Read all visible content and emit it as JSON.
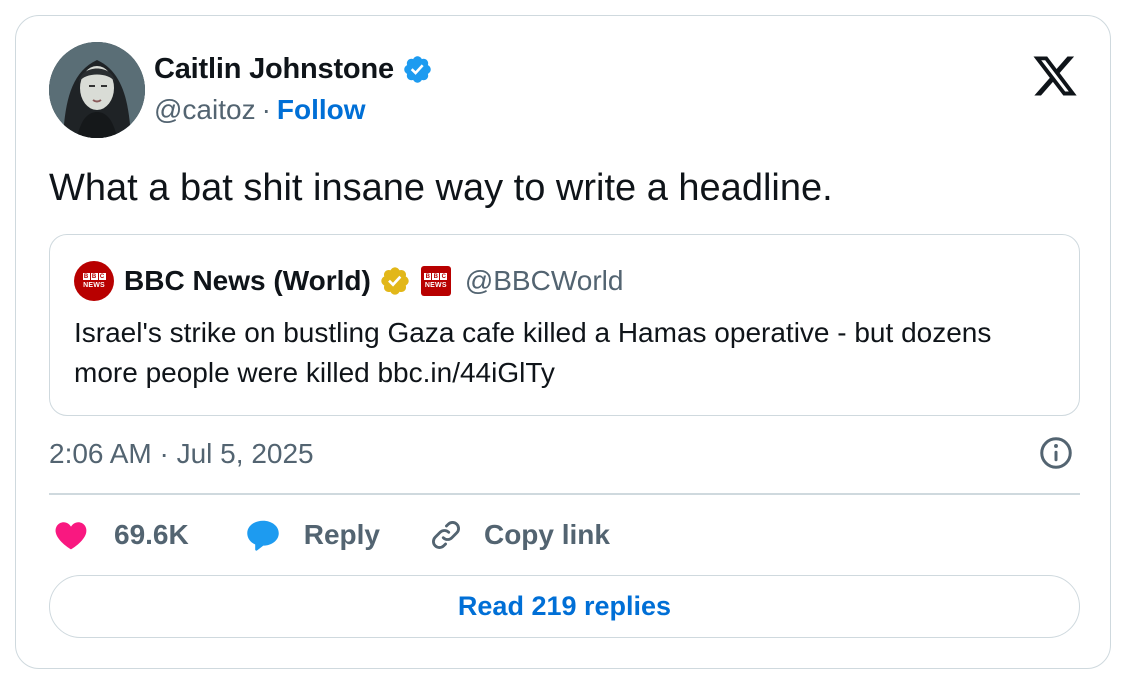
{
  "author": {
    "name": "Caitlin Johnstone",
    "handle": "@caitoz",
    "separator": "·",
    "follow_label": "Follow"
  },
  "tweet": {
    "text": "What a bat shit insane way to write a headline.",
    "timestamp": "2:06 AM · Jul 5, 2025"
  },
  "quoted": {
    "name": "BBC News (World)",
    "handle": "@BBCWorld",
    "text": "Israel's strike on bustling Gaza cafe killed a Hamas operative - but dozens more people were killed bbc.in/44iGlTy",
    "avatar_text": "NEWS"
  },
  "actions": {
    "likes": "69.6K",
    "reply_label": "Reply",
    "copy_label": "Copy link"
  },
  "read_replies_label": "Read 219 replies",
  "colors": {
    "accent": "#006fd6",
    "verified_blue": "#1d9bf0",
    "gold_badge": "#e2b719",
    "like_pink": "#f91880",
    "bbc_red": "#b80000",
    "muted": "#536471",
    "border": "#cfd9de"
  },
  "icons": [
    "x-logo-icon",
    "verified-badge-icon",
    "gold-verified-badge-icon",
    "info-icon",
    "heart-icon",
    "reply-bubble-icon",
    "link-icon"
  ]
}
